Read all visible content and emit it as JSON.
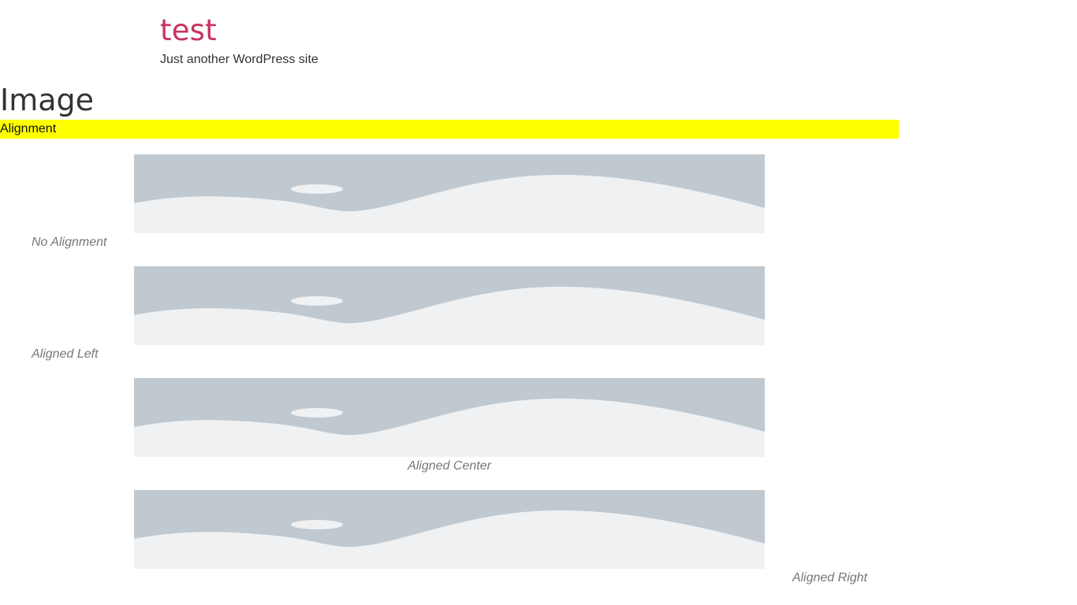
{
  "site": {
    "title": "test",
    "tagline": "Just another WordPress site"
  },
  "page": {
    "title": "Image",
    "section_heading": "Alignment"
  },
  "figures": [
    {
      "caption": "No Alignment",
      "alignment": "none"
    },
    {
      "caption": "Aligned Left",
      "alignment": "left"
    },
    {
      "caption": "Aligned Center",
      "alignment": "center"
    },
    {
      "caption": "Aligned Right",
      "alignment": "right"
    }
  ],
  "colors": {
    "site_title": "#c8335f",
    "section_highlight": "#ffff00",
    "placeholder_sky": "#c0c9d0",
    "placeholder_ground": "#eff1f3",
    "caption_text": "#777777"
  }
}
